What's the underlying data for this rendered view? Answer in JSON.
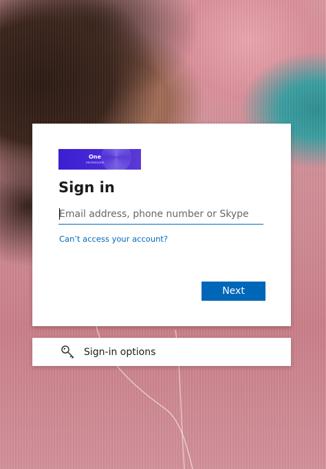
{
  "logo": {
    "brand": "One",
    "subtext": "eoceesscom",
    "icon": "logo-icon"
  },
  "signin": {
    "title": "Sign in",
    "email_placeholder": "Email address, phone number or Skype",
    "email_value": "",
    "cant_access_link": "Can’t access your account?",
    "next_label": "Next"
  },
  "options": {
    "label": "Sign-in options",
    "icon": "key-icon"
  },
  "colors": {
    "accent": "#0067b8",
    "logo_bg": "#3a1fd0",
    "card_bg": "#ffffff"
  }
}
